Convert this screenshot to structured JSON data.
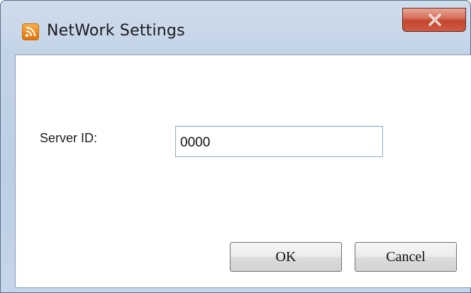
{
  "window": {
    "title": "NetWork Settings",
    "app_icon": "rss-feed-icon",
    "close_icon": "close-icon"
  },
  "form": {
    "server_id_label": "Server ID:",
    "server_id_value": "0000"
  },
  "buttons": {
    "ok_label": "OK",
    "cancel_label": "Cancel"
  },
  "colors": {
    "frame": "#c4d4e8",
    "close_button": "#c4452d",
    "app_icon": "#ef8a1c"
  }
}
